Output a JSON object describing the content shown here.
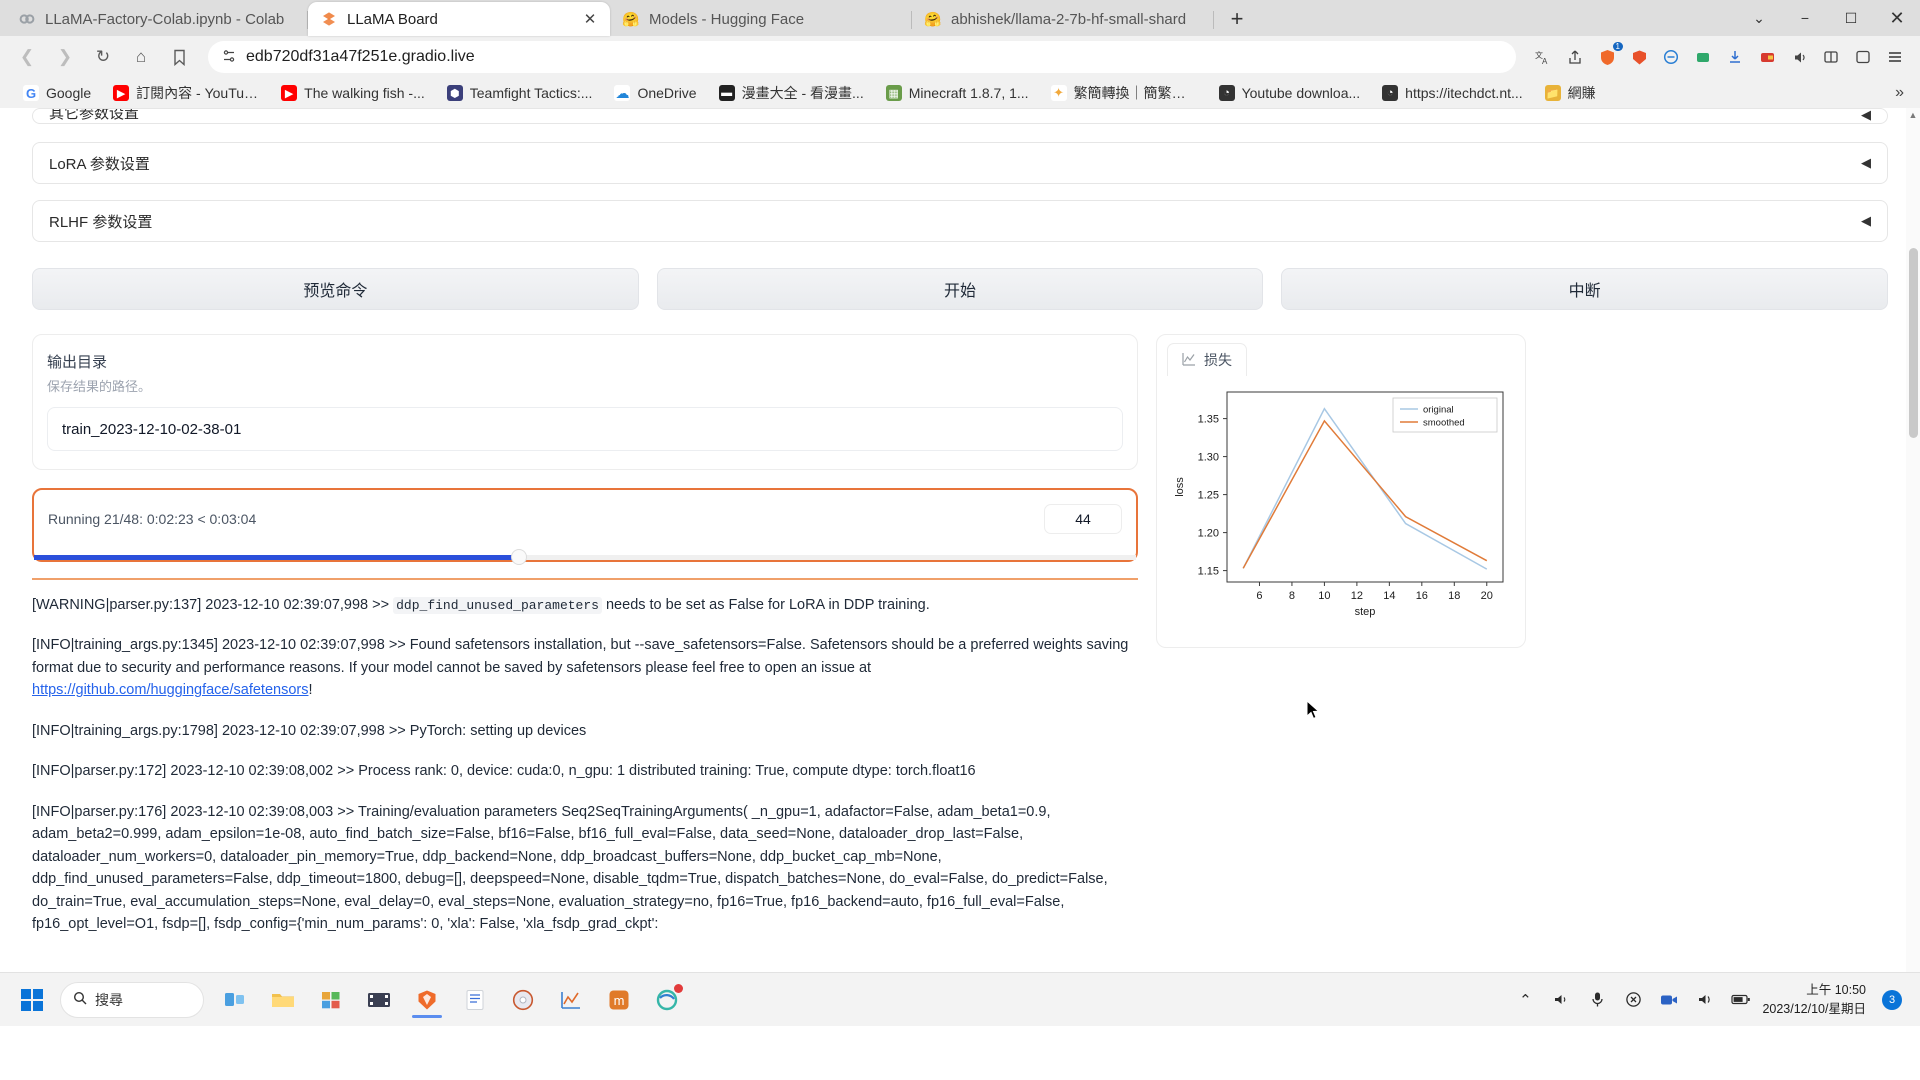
{
  "browser": {
    "tabs": [
      {
        "title": "LLaMA-Factory-Colab.ipynb - Colab",
        "favicon": "colab-icon",
        "active": false
      },
      {
        "title": "LLaMA Board",
        "favicon": "gradio-icon",
        "active": true,
        "close": "✕"
      },
      {
        "title": "Models - Hugging Face",
        "favicon": "huggingface-icon",
        "active": false
      },
      {
        "title": "abhishek/llama-2-7b-hf-small-shard",
        "favicon": "huggingface-icon",
        "active": false
      }
    ],
    "new_tab_label": "+",
    "window_controls": {
      "minimize": "−",
      "maximize": "☐",
      "close": "✕",
      "tab_list": "⌄"
    },
    "nav": {
      "back": "❮",
      "forward": "❯",
      "reload": "↻",
      "home": "⌂",
      "bookmark": "🔖"
    },
    "address": {
      "value": "edb720df31a47f251e.gradio.live",
      "placeholder": "Search or enter web address"
    },
    "toolbar_icons": [
      "translate-icon",
      "share-icon",
      "shield-icon",
      "brave-icon",
      "extension-icon",
      "download-icon",
      "wallet-icon",
      "speaker-icon",
      "collections-icon",
      "split-screen-icon",
      "menu-icon"
    ],
    "bookmarks": [
      {
        "label": "Google",
        "icon": "G",
        "color": "#ffffff"
      },
      {
        "label": "訂閱內容 - YouTube",
        "icon": "▶",
        "color": "#ff0000"
      },
      {
        "label": "The walking fish -...",
        "icon": "▶",
        "color": "#ff0000"
      },
      {
        "label": "Teamfight Tactics:...",
        "icon": "⬢",
        "color": "#3b3f7a"
      },
      {
        "label": "OneDrive",
        "icon": "☁",
        "color": "#2186d9"
      },
      {
        "label": "漫畫大全 - 看漫畫...",
        "icon": "▬",
        "color": "#222222"
      },
      {
        "label": "Minecraft 1.8.7, 1...",
        "icon": "▦",
        "color": "#6a9c4a"
      },
      {
        "label": "繁簡轉換｜簡繁轉...",
        "icon": "✦",
        "color": "#ffffff"
      },
      {
        "label": "Youtube downloa...",
        "icon": "◔",
        "color": "#333333"
      },
      {
        "label": "https://itechdct.nt...",
        "icon": "◔",
        "color": "#333333"
      },
      {
        "label": "網賺",
        "icon": "📁",
        "color": "#e8b339"
      }
    ],
    "bookmarks_overflow": "»"
  },
  "app": {
    "accordions": [
      {
        "label": "其它参数设置",
        "arrow": "◀",
        "clipped": true
      },
      {
        "label": "LoRA 参数设置",
        "arrow": "◀",
        "clipped": false
      },
      {
        "label": "RLHF 参数设置",
        "arrow": "◀",
        "clipped": false
      }
    ],
    "buttons": [
      {
        "label": "预览命令"
      },
      {
        "label": "开始"
      },
      {
        "label": "中断"
      }
    ],
    "output": {
      "label": "输出目录",
      "sublabel": "保存结果的路径。",
      "value": "train_2023-12-10-02-38-01",
      "placeholder": ""
    },
    "progress": {
      "status": "Running 21/48: 0:02:23 < 0:03:04",
      "value": "44",
      "percent": 44
    },
    "logs": [
      {
        "id": "log-warning-ddp",
        "prefix": "[WARNING|parser.py:137] 2023-12-10 02:39:07,998 >> ",
        "code": "ddp_find_unused_parameters",
        "suffix": " needs to be set as False for LoRA in DDP training.",
        "type": "code"
      },
      {
        "id": "log-info-safetensors",
        "text": "[INFO|training_args.py:1345] 2023-12-10 02:39:07,998 >> Found safetensors installation, but --save_safetensors=False. Safetensors should be a preferred weights saving format due to security and performance reasons. If your model cannot be saved by safetensors please feel free to open an issue at ",
        "link": "https://github.com/huggingface/safetensors",
        "after_link": "!",
        "type": "link"
      },
      {
        "id": "log-info-devices",
        "text": "[INFO|training_args.py:1798] 2023-12-10 02:39:07,998 >> PyTorch: setting up devices",
        "type": "plain"
      },
      {
        "id": "log-info-rank",
        "text": "[INFO|parser.py:172] 2023-12-10 02:39:08,002 >> Process rank: 0, device: cuda:0, n_gpu: 1 distributed training: True, compute dtype: torch.float16",
        "type": "plain"
      },
      {
        "id": "log-info-trainingargs",
        "text": "[INFO|parser.py:176] 2023-12-10 02:39:08,003 >> Training/evaluation parameters Seq2SeqTrainingArguments( _n_gpu=1, adafactor=False, adam_beta1=0.9, adam_beta2=0.999, adam_epsilon=1e-08, auto_find_batch_size=False, bf16=False, bf16_full_eval=False, data_seed=None, dataloader_drop_last=False, dataloader_num_workers=0, dataloader_pin_memory=True, ddp_backend=None, ddp_broadcast_buffers=None, ddp_bucket_cap_mb=None, ddp_find_unused_parameters=False, ddp_timeout=1800, debug=[], deepspeed=None, disable_tqdm=True, dispatch_batches=None, do_eval=False, do_predict=False, do_train=True, eval_accumulation_steps=None, eval_delay=0, eval_steps=None, evaluation_strategy=no, fp16=True, fp16_backend=auto, fp16_full_eval=False, fp16_opt_level=O1, fsdp=[], fsdp_config={'min_num_params': 0, 'xla': False, 'xla_fsdp_grad_ckpt':",
        "type": "plain"
      }
    ],
    "chart_tab": {
      "label": "损失",
      "icon": "chart-icon"
    }
  },
  "chart_data": {
    "type": "line",
    "title": "",
    "xlabel": "step",
    "ylabel": "loss",
    "xlim": [
      4,
      21
    ],
    "ylim": [
      1.135,
      1.385
    ],
    "xticks": [
      6,
      8,
      10,
      12,
      14,
      16,
      18,
      20
    ],
    "yticks": [
      1.15,
      1.2,
      1.25,
      1.3,
      1.35
    ],
    "grid": false,
    "legend_position": "upper right",
    "x": [
      5,
      10,
      15,
      20
    ],
    "series": [
      {
        "name": "original",
        "color": "#a8c8e4",
        "values": [
          1.153,
          1.363,
          1.212,
          1.152
        ]
      },
      {
        "name": "smoothed",
        "color": "#e07b39",
        "values": [
          1.153,
          1.347,
          1.221,
          1.163
        ]
      }
    ]
  },
  "taskbar": {
    "search_placeholder": "搜尋",
    "search_icon": "search-icon",
    "apps": [
      "start-icon",
      "taskview-icon",
      "file-explorer-icon",
      "store-icon",
      "movie-maker-icon",
      "brave-icon",
      "word-icon",
      "cd-icon",
      "chart-app-icon",
      "m-app-icon",
      "edge-icon"
    ],
    "tray": [
      "chevron-up-icon",
      "volume-icon",
      "mic-icon",
      "close-icon",
      "camera-icon",
      "speaker-icon",
      "battery-icon"
    ],
    "clock_time": "上午 10:50",
    "clock_date": "2023/12/10/星期日",
    "notification_count": "3"
  }
}
